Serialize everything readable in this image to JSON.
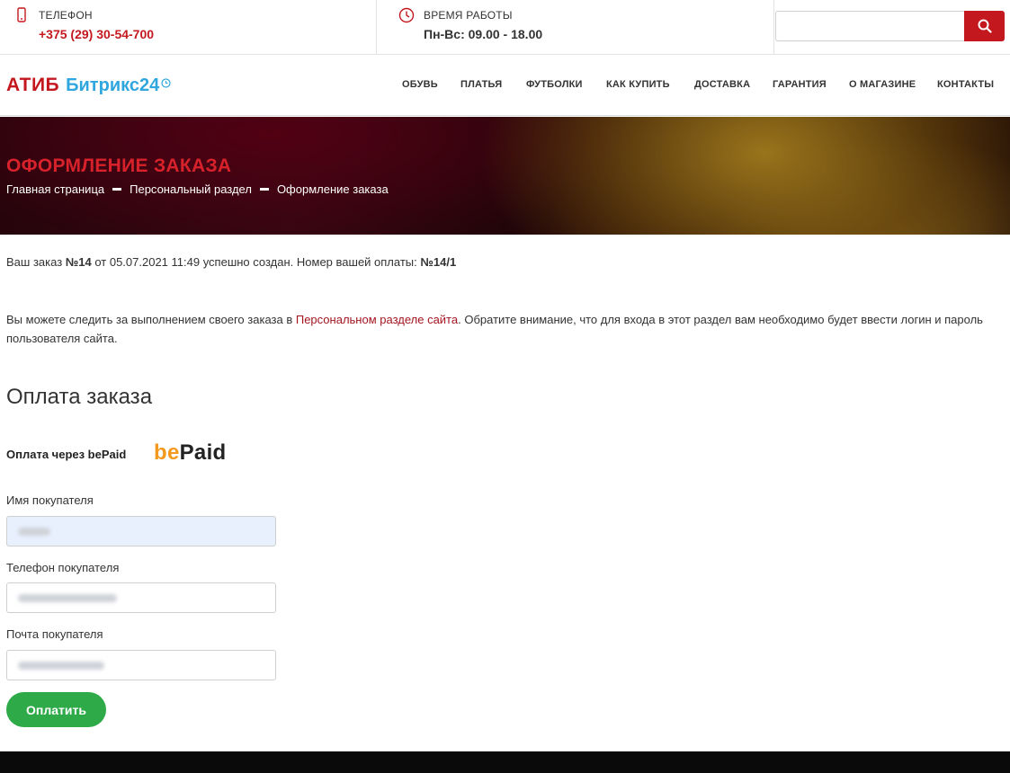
{
  "topbar": {
    "phone": {
      "label": "ТЕЛЕФОН",
      "value": "+375 (29) 30-54-700",
      "icon": "phone-icon"
    },
    "hours": {
      "label": "ВРЕМЯ РАБОТЫ",
      "value": "Пн-Вс: 09.00 - 18.00",
      "icon": "clock-icon"
    },
    "search": {
      "placeholder": "",
      "icon": "search-icon"
    }
  },
  "logo": {
    "part1": "АТИБ",
    "part2": "Битрикс24"
  },
  "nav": {
    "items": [
      "ОБУВЬ",
      "ПЛАТЬЯ",
      "ФУТБОЛКИ",
      "КАК КУПИТЬ",
      "ДОСТАВКА",
      "ГАРАНТИЯ",
      "О МАГАЗИНЕ",
      "КОНТАКТЫ"
    ]
  },
  "banner": {
    "title": "ОФОРМЛЕНИЕ ЗАКАЗА",
    "breadcrumb": [
      "Главная страница",
      "Персональный раздел",
      "Оформление заказа"
    ]
  },
  "order": {
    "prefix": "Ваш заказ ",
    "number": "№14",
    "middle": " от 05.07.2021 11:49 успешно создан. Номер вашей оплаты: ",
    "payment_number": "№14/1"
  },
  "info": {
    "before": "Вы можете следить за выполнением своего заказа в ",
    "link": "Персональном разделе сайта",
    "after": ". Обратите внимание, что для входа в этот раздел вам необходимо будет ввести логин и пароль пользователя сайта."
  },
  "payment": {
    "title": "Оплата заказа",
    "via_label": "Оплата через bePaid",
    "logo_be": "be",
    "logo_paid": "Paid",
    "fields": [
      {
        "label": "Имя покупателя"
      },
      {
        "label": "Телефон покупателя"
      },
      {
        "label": "Почта покупателя"
      }
    ],
    "submit_label": "Оплатить"
  },
  "colors": {
    "brand_red": "#c4181f",
    "logo_blue": "#2fa6de",
    "pay_green": "#2eaa48",
    "link": "#a31620",
    "bepaid_orange": "#f39a1e"
  }
}
